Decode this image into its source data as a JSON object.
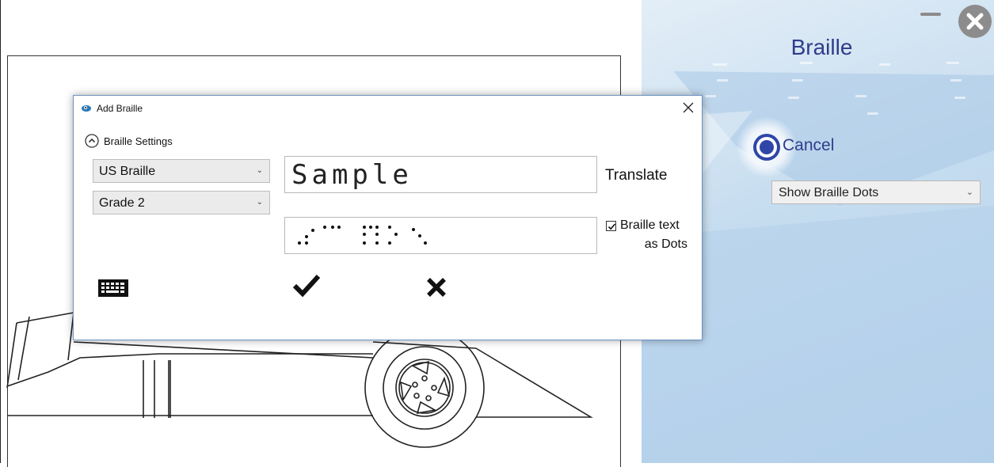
{
  "panel": {
    "title": "Braille",
    "cancel_label": "Cancel",
    "display_mode": "Show Braille Dots",
    "minimize_icon": "minimize-icon",
    "close_icon": "close-circle-icon"
  },
  "dialog": {
    "title": "Add Braille",
    "settings_label": "Braille Settings",
    "language": "US Braille",
    "grade": "Grade 2",
    "input_text": "Sample",
    "translate_label": "Translate",
    "braille_output": "⠠⠎⠁⠍⠏⠇⠑",
    "dots_checkbox_checked": true,
    "dots_checkbox_label_line1": "Braille text",
    "dots_checkbox_label_line2": "as Dots",
    "keyboard_icon": "keyboard-icon",
    "ok_icon": "checkmark-icon",
    "cancel_icon": "x-icon"
  },
  "colors": {
    "accent": "#2f45a8",
    "title_text": "#2f3d8a",
    "dialog_border": "#6d93c3"
  }
}
